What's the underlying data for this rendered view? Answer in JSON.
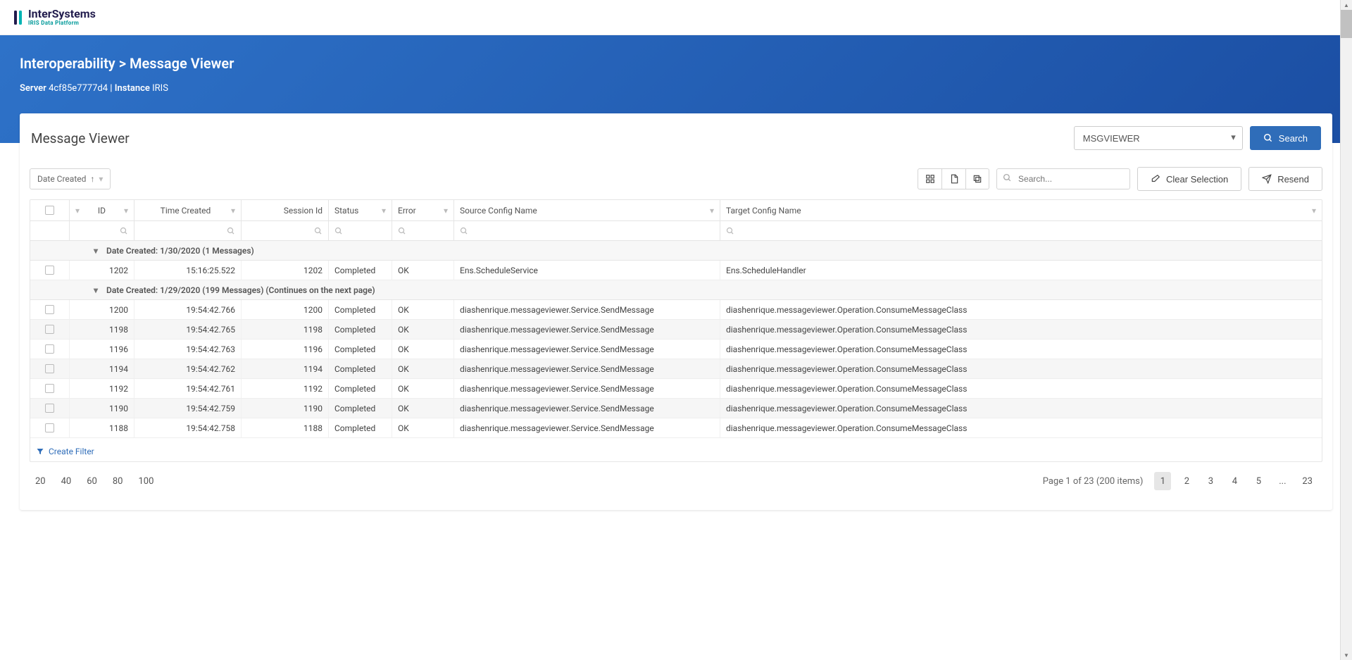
{
  "logo": {
    "main": "InterSystems",
    "sub": "IRIS Data Platform"
  },
  "hero": {
    "title": "Interoperability > Message Viewer",
    "server_label": "Server",
    "server_value": "4cf85e7777d4",
    "divider": " | ",
    "instance_label": "Instance",
    "instance_value": "IRIS"
  },
  "panel": {
    "title": "Message Viewer",
    "namespace_select": "MSGVIEWER",
    "search_btn": "Search"
  },
  "toolbar": {
    "sort_chip": "Date Created",
    "search_placeholder": "Search...",
    "clear_selection": "Clear Selection",
    "resend": "Resend"
  },
  "columns": {
    "id": "ID",
    "time": "Time Created",
    "session": "Session Id",
    "status": "Status",
    "error": "Error",
    "source": "Source Config Name",
    "target": "Target Config Name"
  },
  "groups": [
    {
      "label": "Date Created: 1/30/2020 (1 Messages)",
      "rows": [
        {
          "id": "1202",
          "time": "15:16:25.522",
          "session": "1202",
          "status": "Completed",
          "error": "OK",
          "source": "Ens.ScheduleService",
          "target": "Ens.ScheduleHandler"
        }
      ]
    },
    {
      "label": "Date Created: 1/29/2020 (199 Messages) (Continues on the next page)",
      "rows": [
        {
          "id": "1200",
          "time": "19:54:42.766",
          "session": "1200",
          "status": "Completed",
          "error": "OK",
          "source": "diashenrique.messageviewer.Service.SendMessage",
          "target": "diashenrique.messageviewer.Operation.ConsumeMessageClass"
        },
        {
          "id": "1198",
          "time": "19:54:42.765",
          "session": "1198",
          "status": "Completed",
          "error": "OK",
          "source": "diashenrique.messageviewer.Service.SendMessage",
          "target": "diashenrique.messageviewer.Operation.ConsumeMessageClass"
        },
        {
          "id": "1196",
          "time": "19:54:42.763",
          "session": "1196",
          "status": "Completed",
          "error": "OK",
          "source": "diashenrique.messageviewer.Service.SendMessage",
          "target": "diashenrique.messageviewer.Operation.ConsumeMessageClass"
        },
        {
          "id": "1194",
          "time": "19:54:42.762",
          "session": "1194",
          "status": "Completed",
          "error": "OK",
          "source": "diashenrique.messageviewer.Service.SendMessage",
          "target": "diashenrique.messageviewer.Operation.ConsumeMessageClass"
        },
        {
          "id": "1192",
          "time": "19:54:42.761",
          "session": "1192",
          "status": "Completed",
          "error": "OK",
          "source": "diashenrique.messageviewer.Service.SendMessage",
          "target": "diashenrique.messageviewer.Operation.ConsumeMessageClass"
        },
        {
          "id": "1190",
          "time": "19:54:42.759",
          "session": "1190",
          "status": "Completed",
          "error": "OK",
          "source": "diashenrique.messageviewer.Service.SendMessage",
          "target": "diashenrique.messageviewer.Operation.ConsumeMessageClass"
        },
        {
          "id": "1188",
          "time": "19:54:42.758",
          "session": "1188",
          "status": "Completed",
          "error": "OK",
          "source": "diashenrique.messageviewer.Service.SendMessage",
          "target": "diashenrique.messageviewer.Operation.ConsumeMessageClass"
        }
      ]
    }
  ],
  "create_filter": "Create Filter",
  "pager": {
    "sizes": [
      "20",
      "40",
      "60",
      "80",
      "100"
    ],
    "info": "Page 1 of 23 (200 items)",
    "pages": [
      "1",
      "2",
      "3",
      "4",
      "5",
      "...",
      "23"
    ],
    "active": "1"
  }
}
